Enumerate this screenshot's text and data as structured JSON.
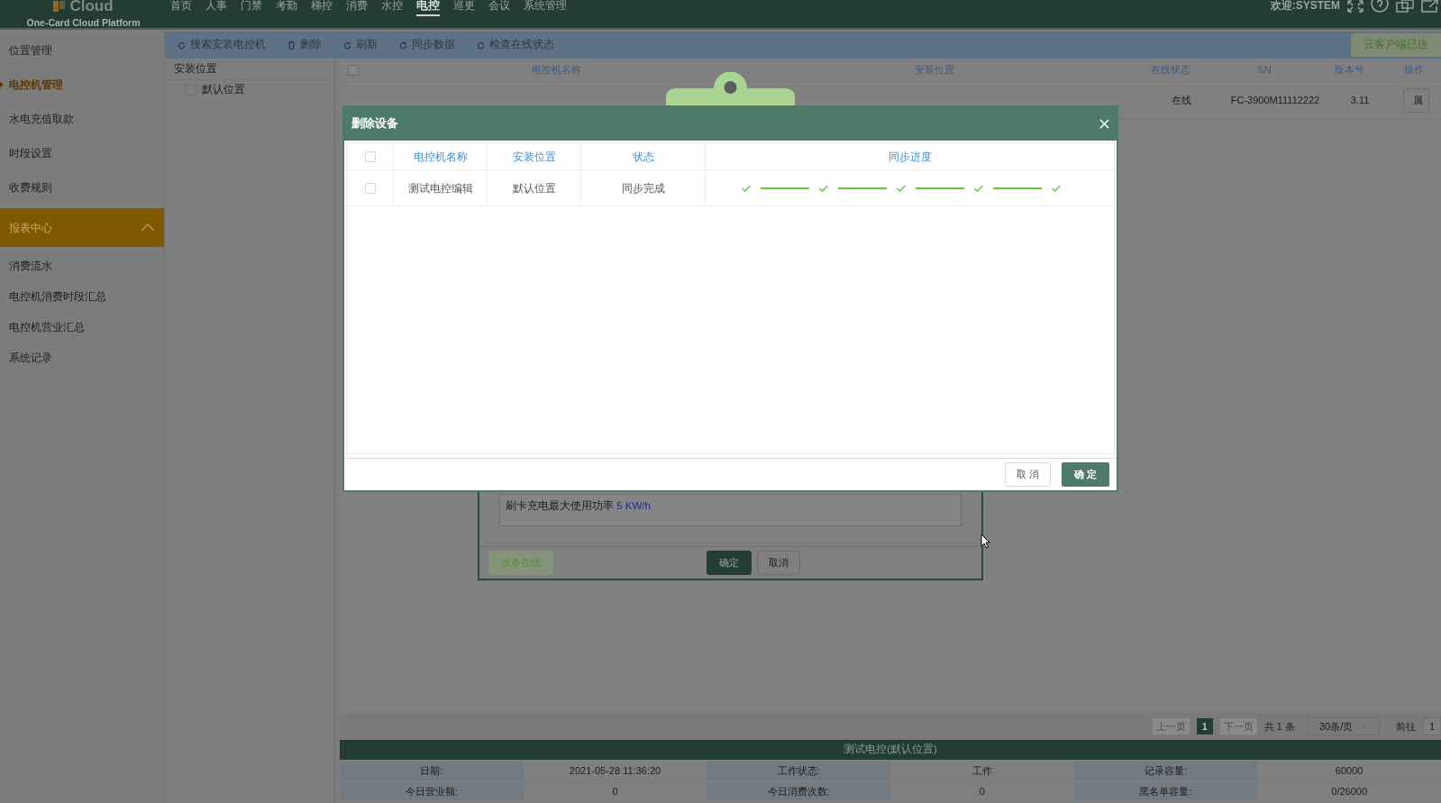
{
  "header": {
    "logo_text": "Cloud",
    "subtitle": "One-Card Cloud Platform",
    "nav": [
      {
        "label": "首页",
        "selected": false
      },
      {
        "label": "人事",
        "selected": false
      },
      {
        "label": "门禁",
        "selected": false
      },
      {
        "label": "考勤",
        "selected": false
      },
      {
        "label": "梯控",
        "selected": false
      },
      {
        "label": "消费",
        "selected": false
      },
      {
        "label": "水控",
        "selected": false
      },
      {
        "label": "电控",
        "selected": true
      },
      {
        "label": "巡更",
        "selected": false
      },
      {
        "label": "会议",
        "selected": false
      },
      {
        "label": "系统管理",
        "selected": false
      }
    ],
    "welcome": "欢迎:SYSTEM"
  },
  "sidebar": {
    "items": [
      {
        "label": "位置管理",
        "kind": "item",
        "selected": false
      },
      {
        "label": "电控机管理",
        "kind": "item",
        "selected": true
      },
      {
        "label": "水电充值取款",
        "kind": "item",
        "selected": false
      },
      {
        "label": "时段设置",
        "kind": "item",
        "selected": false
      },
      {
        "label": "收费规则",
        "kind": "item",
        "selected": false
      },
      {
        "label": "报表中心",
        "kind": "group",
        "expanded": true
      },
      {
        "label": "消费流水",
        "kind": "item",
        "selected": false
      },
      {
        "label": "电控机消费时段汇总",
        "kind": "item",
        "selected": false
      },
      {
        "label": "电控机营业汇总",
        "kind": "item",
        "selected": false
      },
      {
        "label": "系统记录",
        "kind": "item",
        "selected": false
      }
    ]
  },
  "toolbar": {
    "buttons": [
      {
        "label": "搜索安装电控机",
        "kind": "refresh"
      },
      {
        "label": "删除",
        "kind": "trash"
      },
      {
        "label": "刷新",
        "kind": "refresh"
      },
      {
        "label": "同步数据",
        "kind": "refresh"
      },
      {
        "label": "检查在线状态",
        "kind": "refresh"
      }
    ],
    "status": "云客户端已连"
  },
  "tree": {
    "title": "安装位置",
    "items": [
      {
        "label": "默认位置",
        "checked": false
      }
    ]
  },
  "table": {
    "all_checked": false,
    "columns": [
      "电控机名称",
      "安装位置",
      "在线状态",
      "SN",
      "版本号",
      "操作"
    ],
    "rows": [
      {
        "status": "在线",
        "sn": "FC-3900M11112222",
        "version": "3.11",
        "action": "属"
      }
    ]
  },
  "modal": {
    "title": "删除设备",
    "all_checked": false,
    "columns": [
      "电控机名称",
      "安装位置",
      "状态",
      "同步进度"
    ],
    "rows": [
      {
        "checked": false,
        "name": "测试电控编辑",
        "location": "默认位置",
        "status": "同步完成",
        "steps": [
          {
            "done": true
          },
          {
            "done": true
          },
          {
            "done": true
          },
          {
            "done": true
          },
          {
            "done": true
          }
        ]
      }
    ],
    "cancel": "取 消",
    "confirm": "确 定"
  },
  "device_dialog": {
    "note_label": "刷卡充电最大使用功率",
    "note_value": "5 KW/h",
    "online": "设备在线",
    "confirm": "确定",
    "cancel": "取消"
  },
  "pagination": {
    "prev": "上一页",
    "pages": [
      {
        "label": "1",
        "selected": true
      }
    ],
    "next": "下一页",
    "total": "共 1 条",
    "page_size": "30条/页",
    "goto": "前往",
    "goto_value": "1"
  },
  "device_panel": {
    "title": "测试电控(默认位置)",
    "rows": [
      [
        "日期:",
        "2021-05-28 11:36:20",
        "工作状态:",
        "工作",
        "记录容量:",
        "60000"
      ],
      [
        "今日营业额:",
        "0",
        "今日消费次数:",
        "0",
        "黑名单容量:",
        "0/26000"
      ]
    ]
  }
}
